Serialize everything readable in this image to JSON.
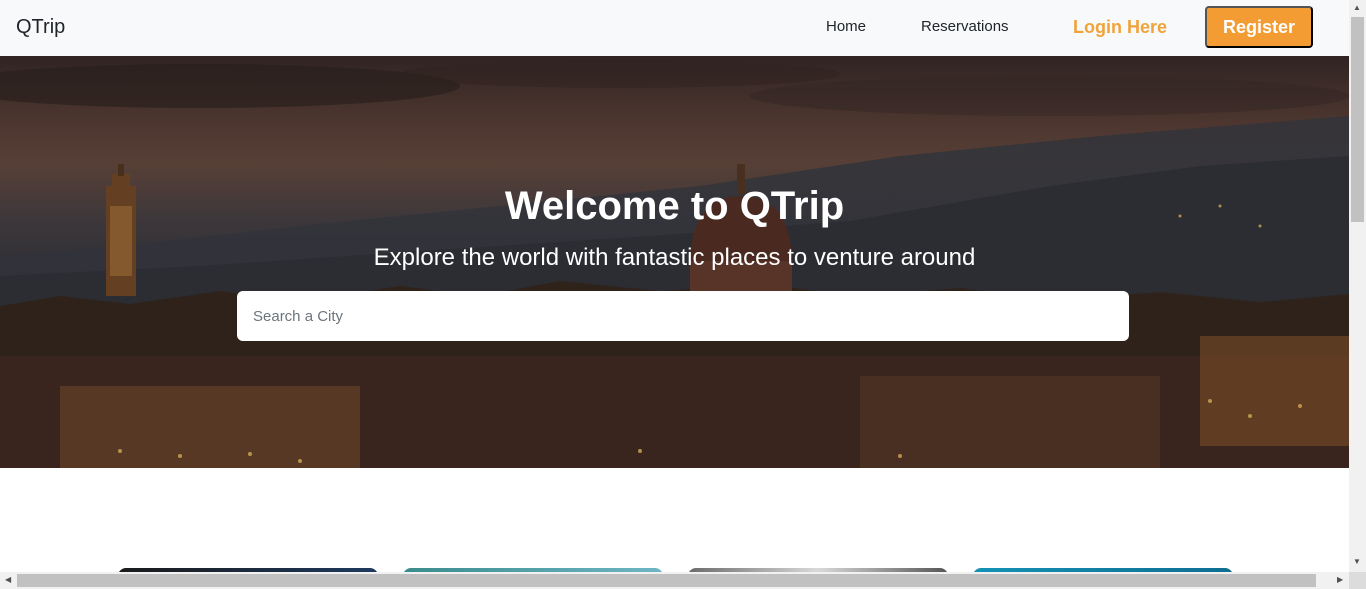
{
  "navbar": {
    "brand": "QTrip",
    "links": [
      "Home",
      "Reservations"
    ],
    "login_label": "Login Here",
    "register_label": "Register"
  },
  "hero": {
    "title": "Welcome to QTrip",
    "subtitle": "Explore the world with fantastic places to venture around",
    "search_placeholder": "Search a City"
  },
  "colors": {
    "accent": "#f39c34",
    "login_text": "#f0a33a",
    "navbar_bg": "#f8f9fa"
  },
  "icons": {
    "scroll_up": "chevron-up-icon",
    "scroll_down": "chevron-down-icon",
    "scroll_left": "chevron-left-icon",
    "scroll_right": "chevron-right-icon"
  }
}
